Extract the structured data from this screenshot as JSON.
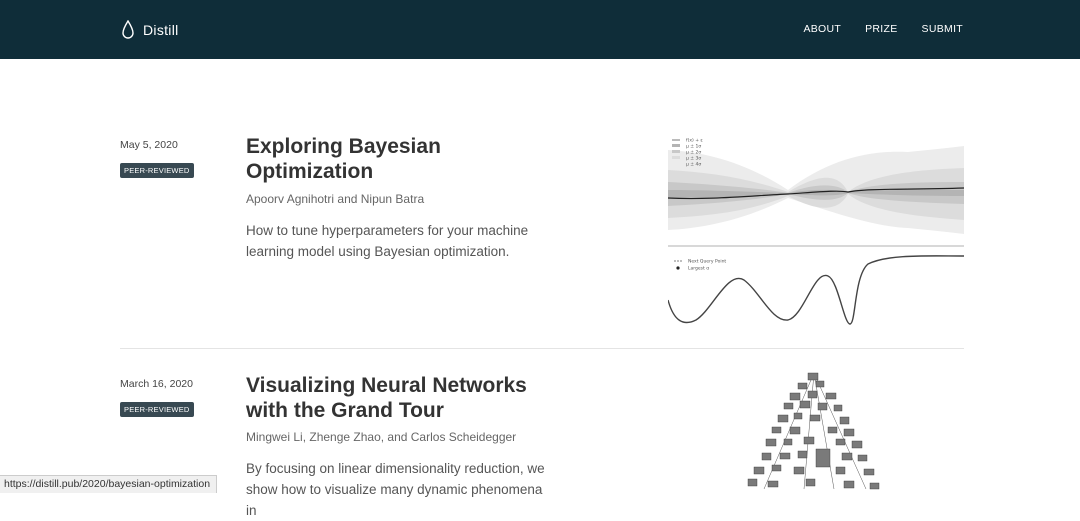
{
  "site": {
    "name": "Distill",
    "logo_icon": "droplet-icon"
  },
  "nav": [
    {
      "label": "ABOUT"
    },
    {
      "label": "PRIZE"
    },
    {
      "label": "SUBMIT"
    }
  ],
  "articles": [
    {
      "date": "May 5, 2020",
      "badge": "PEER-REVIEWED",
      "title": "Exploring Bayesian Optimization",
      "authors": "Apoorv Agnihotri and Nipun Batra",
      "description": "How to tune hyperparameters for your machine learning model using Bayesian optimization.",
      "thumbnail": {
        "legend_top": [
          "f(x) + ε",
          "μ ± 1σ",
          "μ ± 2σ",
          "μ ± 3σ",
          "μ ± 4σ"
        ],
        "legend_bottom": [
          "Next Query Point",
          "Largest α"
        ]
      }
    },
    {
      "date": "March 16, 2020",
      "badge": "PEER-REVIEWED",
      "title": "Visualizing Neural Networks with the Grand Tour",
      "authors": "Mingwei Li, Zhenge Zhao, and Carlos Scheidegger",
      "description": "By focusing on linear dimensionality reduction, we show how to visualize many dynamic phenomena in"
    }
  ],
  "status_bar": {
    "url": "https://distill.pub/2020/bayesian-optimization"
  }
}
